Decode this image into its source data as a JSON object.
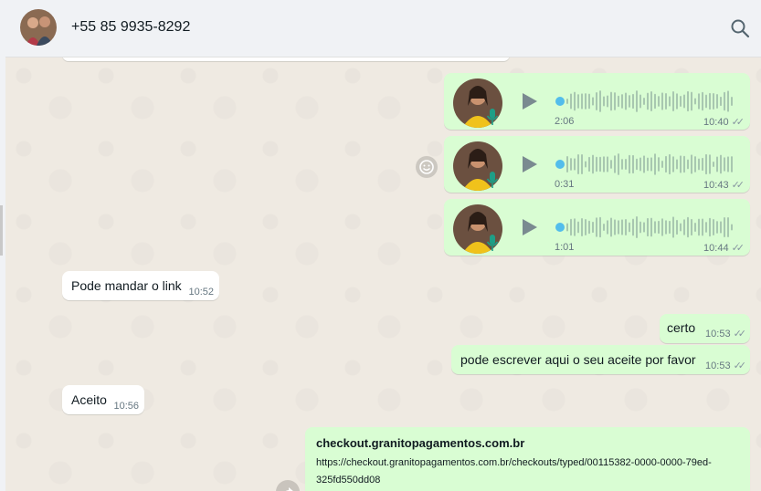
{
  "header": {
    "contact_name": "+55 85 9935-8292",
    "icons": {
      "search": "search-icon",
      "avatar": "contact-avatar"
    }
  },
  "messages": {
    "audio": [
      {
        "duration": "2:06",
        "time": "10:40",
        "progress": 0
      },
      {
        "duration": "0:31",
        "time": "10:43",
        "progress": 0
      },
      {
        "duration": "1:01",
        "time": "10:44",
        "progress": 0
      }
    ],
    "text": [
      {
        "direction": "in",
        "text": "Pode mandar o link",
        "time": "10:52"
      },
      {
        "direction": "out",
        "text": "certo",
        "time": "10:53"
      },
      {
        "direction": "out",
        "text": "pode escrever aqui o seu aceite por favor",
        "time": "10:53"
      },
      {
        "direction": "in",
        "text": "Aceito",
        "time": "10:56"
      }
    ],
    "link": {
      "title": "checkout.granitopagamentos.com.br",
      "url": "https://checkout.granitopagamentos.com.br/checkouts/typed/00115382-0000-0000-79ed-325fd550dd08"
    }
  },
  "read_ticks": "✓✓",
  "colors": {
    "outgoing": "#d9fdd3",
    "incoming": "#ffffff",
    "wallpaper": "#efeae2",
    "accent": "#53bdeb",
    "header": "#f0f2f5"
  }
}
